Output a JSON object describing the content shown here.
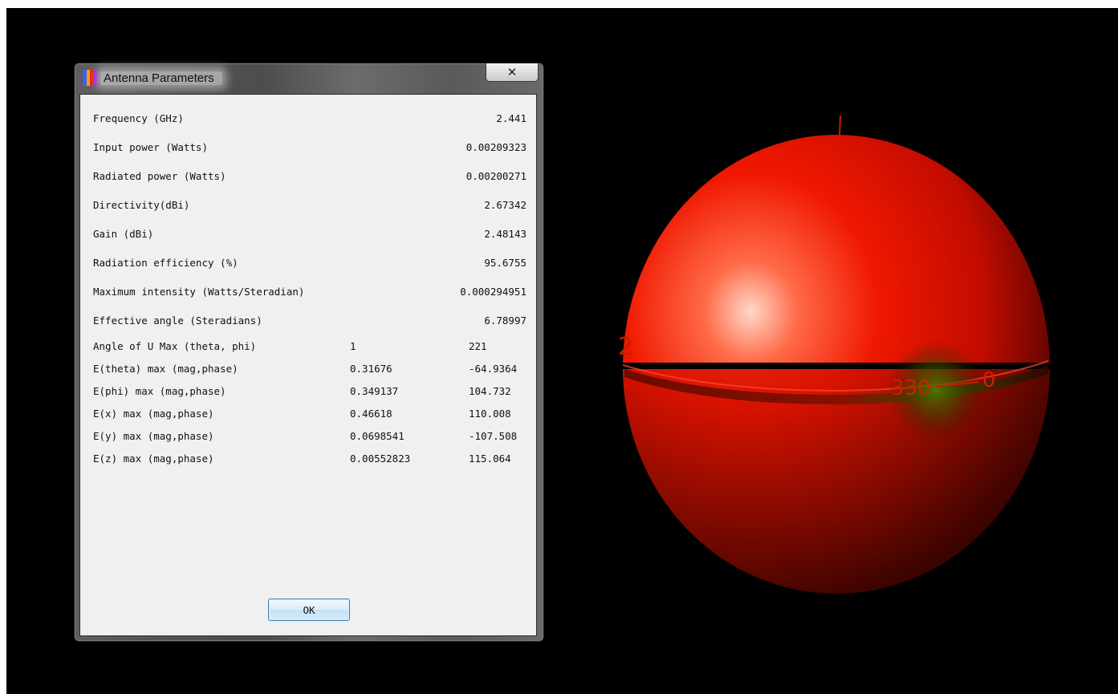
{
  "dialog": {
    "title": "Antenna Parameters",
    "close_glyph": "✕",
    "icon": "spectrum-bars-icon",
    "ok_label": "OK"
  },
  "params": [
    {
      "label": "Frequency (GHz)",
      "value": "2.441"
    },
    {
      "label": "Input power (Watts)",
      "value": "0.00209323"
    },
    {
      "label": "Radiated power (Watts)",
      "value": "0.00200271"
    },
    {
      "label": "Directivity(dBi)",
      "value": "2.67342"
    },
    {
      "label": "Gain (dBi)",
      "value": "2.48143"
    },
    {
      "label": "Radiation efficiency (%)",
      "value": "95.6755"
    },
    {
      "label": "Maximum intensity (Watts/Steradian)",
      "value": "0.000294951"
    },
    {
      "label": "Effective angle (Steradians)",
      "value": "6.78997"
    }
  ],
  "fields": [
    {
      "label": "Angle of U Max (theta, phi)",
      "a": "1",
      "b": "221"
    },
    {
      "label": "E(theta) max (mag,phase)",
      "a": "0.31676",
      "b": "-64.9364"
    },
    {
      "label": "E(phi) max (mag,phase)",
      "a": "0.349137",
      "b": "104.732"
    },
    {
      "label": "E(x) max (mag,phase)",
      "a": "0.46618",
      "b": "110.008"
    },
    {
      "label": "E(y) max (mag,phase)",
      "a": "0.0698541",
      "b": "-107.508"
    },
    {
      "label": "E(z) max (mag,phase)",
      "a": "0.00552823",
      "b": "115.064"
    }
  ],
  "pattern": {
    "colors": {
      "main": "#e01000",
      "highlight": "#ffd0c0",
      "null_zone": "#4a7a00",
      "axis_labels": "#d02000",
      "background": "#000000"
    },
    "axis_labels": [
      "2",
      "330",
      "0"
    ]
  }
}
